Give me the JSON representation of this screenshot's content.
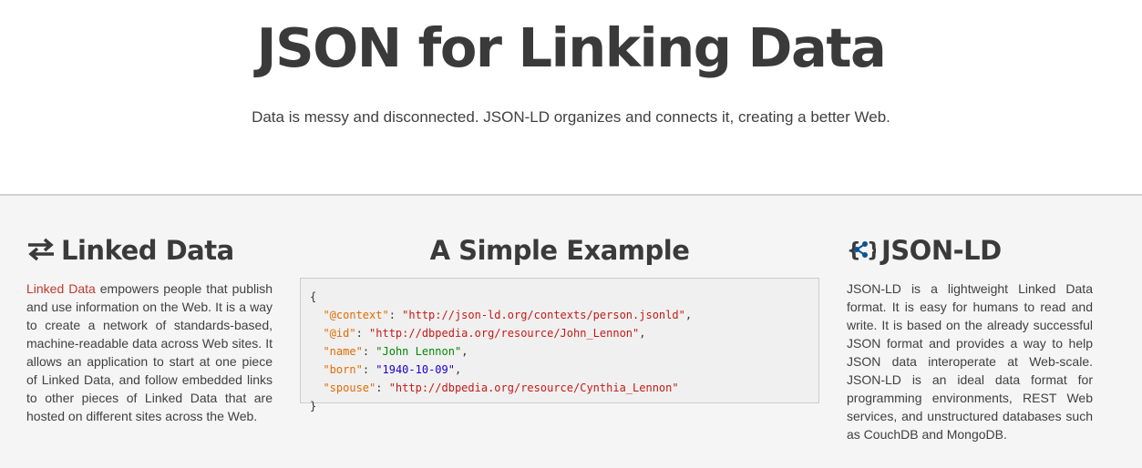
{
  "hero": {
    "title": "JSON for Linking Data",
    "tagline": "Data is messy and disconnected. JSON-LD organizes and connects it, creating a better Web."
  },
  "linked_data": {
    "heading": "Linked Data",
    "icon": "exchange-arrows-icon",
    "link_text": "Linked Data",
    "body": " empowers people that publish and use information on the Web. It is a way to create a network of standards-based, machine-readable data across Web sites. It allows an application to start at one piece of Linked Data, and follow embedded links to other pieces of Linked Data that are hosted on different sites across the Web."
  },
  "example": {
    "heading": "A Simple Example",
    "open_brace": "{",
    "close_brace": "}",
    "lines": [
      {
        "key": "\"@context\"",
        "value": "\"http://json-ld.org/contexts/person.jsonld\"",
        "comma": ","
      },
      {
        "key": "\"@id\"",
        "value": "\"http://dbpedia.org/resource/John_Lennon\"",
        "comma": ","
      },
      {
        "key": "\"name\"",
        "value": "\"John Lennon\"",
        "comma": ","
      },
      {
        "key": "\"born\"",
        "value": "\"1940-10-09\"",
        "comma": ","
      },
      {
        "key": "\"spouse\"",
        "value": "\"http://dbpedia.org/resource/Cynthia_Lennon\"",
        "comma": ""
      }
    ],
    "colors": {
      "key": "#e06c00",
      "url": "#c41a16",
      "name": "#008800",
      "date": "#1c00cf"
    }
  },
  "jsonld": {
    "heading": "JSON-LD",
    "icon": "json-ld-logo-icon",
    "body": "JSON-LD is a lightweight Linked Data format. It is easy for humans to read and write. It is based on the already successful JSON format and provides a way to help JSON data interoperate at Web-scale. JSON-LD is an ideal data format for programming environments, REST Web services, and unstructured databases such as CouchDB and MongoDB."
  }
}
